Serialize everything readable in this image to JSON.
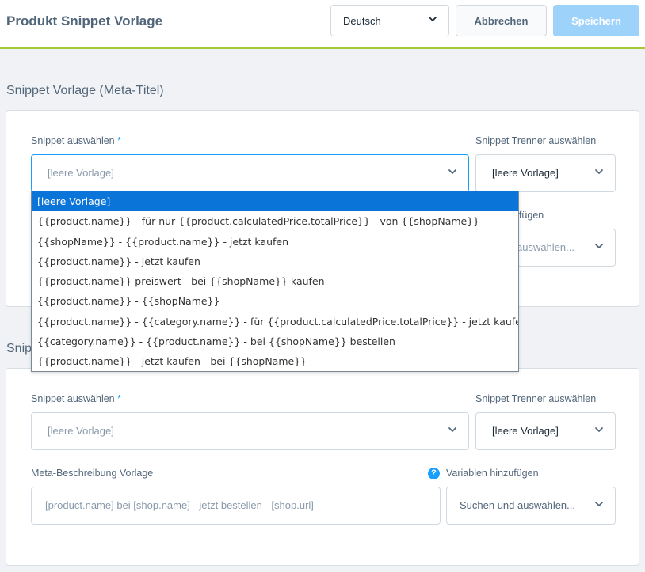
{
  "header": {
    "title": "Produkt Snippet Vorlage",
    "language": "Deutsch",
    "cancel_label": "Abbrechen",
    "save_label": "Speichern"
  },
  "section1": {
    "title": "Snippet Vorlage (Meta-Titel)",
    "snippet_label": "Snippet auswählen",
    "required_mark": "*",
    "snippet_value": "[leere Vorlage]",
    "separator_label": "Snippet Trenner auswählen",
    "separator_value": "[leere Vorlage]",
    "variables_label_partial": "ufügen",
    "variables_value_partial": "auswählen..."
  },
  "dropdown": {
    "options": [
      "[leere Vorlage]",
      "{{product.name}} - für nur {{product.calculatedPrice.totalPrice}} - von {{shopName}}",
      "{{shopName}} - {{product.name}} - jetzt kaufen",
      "{{product.name}} - jetzt kaufen",
      "{{product.name}} preiswert - bei {{shopName}} kaufen",
      "{{product.name}} - {{shopName}}",
      "{{product.name}} - {{category.name}} - für {{product.calculatedPrice.totalPrice}} - jetzt kaufen",
      "{{category.name}} - {{product.name}} - bei {{shopName}} bestellen",
      "{{product.name}} - jetzt kaufen - bei {{shopName}}"
    ]
  },
  "section2": {
    "title_partial": "Snip",
    "snippet_label": "Snippet auswählen",
    "required_mark": "*",
    "snippet_value": "[leere Vorlage]",
    "separator_label": "Snippet Trenner auswählen",
    "separator_value": "[leere Vorlage]",
    "description_label": "Meta-Beschreibung Vorlage",
    "description_placeholder": "[product.name] bei [shop.name] - jetzt bestellen - [shop.url]",
    "help_icon_glyph": "?",
    "variables_label": "Variablen hinzufügen",
    "variables_placeholder": "Suchen und auswählen..."
  },
  "colors": {
    "accent": "#189eff",
    "save_disabled": "#9dd2fb",
    "header_underline": "#a6c836",
    "dropdown_selected": "#0a74d8"
  },
  "icons": {
    "chevron": "chevron-down-icon",
    "help": "help-icon"
  }
}
